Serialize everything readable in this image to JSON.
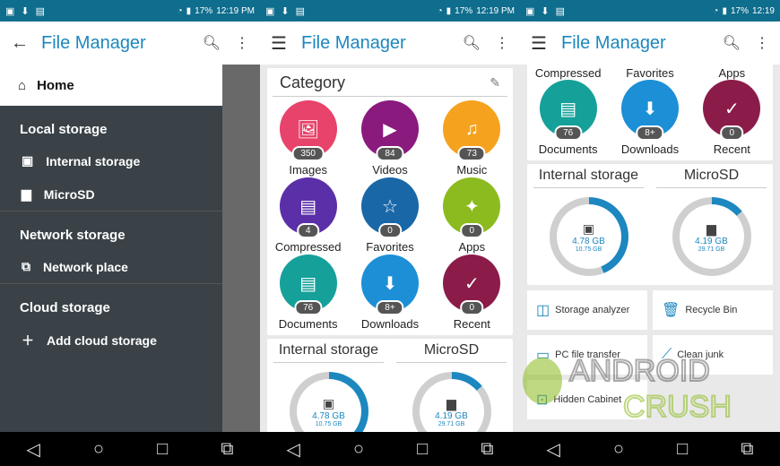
{
  "status": {
    "battery": "17%",
    "time": "12:19 PM",
    "time_short": "12:19"
  },
  "app": {
    "title": "File Manager"
  },
  "drawer": {
    "home": "Home",
    "local_header": "Local storage",
    "internal": "Internal storage",
    "microsd": "MicroSD",
    "network_header": "Network storage",
    "network_place": "Network place",
    "cloud_header": "Cloud storage",
    "add_cloud": "Add cloud storage"
  },
  "category": {
    "title": "Category",
    "items": [
      {
        "label": "Images",
        "count": "350",
        "color": "#e8436a",
        "icon": "🖼"
      },
      {
        "label": "Videos",
        "count": "84",
        "color": "#8a1a7e",
        "icon": "▶"
      },
      {
        "label": "Music",
        "count": "73",
        "color": "#f5a21e",
        "icon": "♫"
      },
      {
        "label": "Compressed",
        "count": "4",
        "color": "#5b2fa8",
        "icon": "▤"
      },
      {
        "label": "Favorites",
        "count": "0",
        "color": "#1a67a8",
        "icon": "☆"
      },
      {
        "label": "Apps",
        "count": "0",
        "color": "#8cbb1f",
        "icon": "✦"
      },
      {
        "label": "Documents",
        "count": "76",
        "color": "#16a09a",
        "icon": "▤"
      },
      {
        "label": "Downloads",
        "count": "8+",
        "color": "#1c8fd6",
        "icon": "⬇"
      },
      {
        "label": "Recent",
        "count": "0",
        "color": "#8b1c4a",
        "icon": "✓"
      }
    ]
  },
  "storage": {
    "internal_label": "Internal storage",
    "internal_used": "4.78 GB",
    "internal_total": "10.75 GB",
    "internal_fraction": 0.44,
    "microsd_label": "MicroSD",
    "microsd_used": "4.19 GB",
    "microsd_total": "29.71 GB",
    "microsd_fraction": 0.14
  },
  "tools": {
    "analyzer": "Storage analyzer",
    "recycle": "Recycle Bin",
    "pc": "PC file transfer",
    "junk": "Clean junk",
    "hidden": "Hidden Cabinet"
  },
  "watermark": {
    "line1": "ANDROID",
    "line2": "CRUSH"
  }
}
